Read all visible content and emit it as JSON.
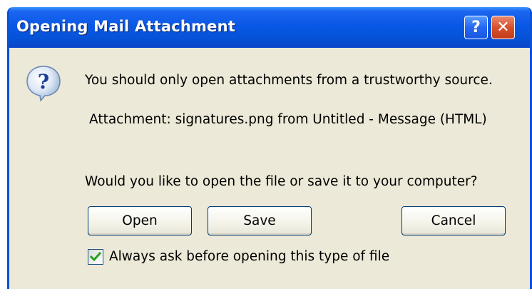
{
  "dialog": {
    "title": "Opening Mail Attachment",
    "help_symbol": "?",
    "close_symbol": "✕",
    "icon": "question-icon",
    "message_warning": "You should only open attachments from a trustworthy source.",
    "message_attachment": "Attachment: signatures.png from Untitled - Message (HTML)",
    "message_question": "Would you like to open the file or save it to your computer?",
    "buttons": {
      "open_label": "Open",
      "save_label": "Save",
      "cancel_label": "Cancel"
    },
    "checkbox": {
      "label": "Always ask before opening this type of file",
      "checked": true
    }
  },
  "colors": {
    "titlebar_blue": "#0653d8",
    "dialog_background": "#ece9d8",
    "close_button_red": "#d8502e",
    "checkmark_green": "#21a121"
  }
}
